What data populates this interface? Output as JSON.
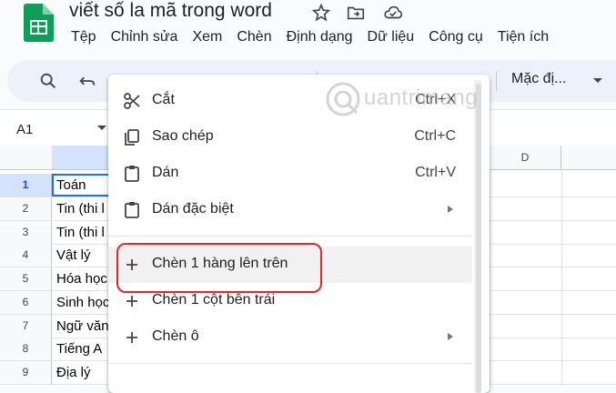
{
  "app": {
    "doc_title": "viết số la mã trong word",
    "menu": [
      "Tệp",
      "Chỉnh sửa",
      "Xem",
      "Chèn",
      "Định dạng",
      "Dữ liệu",
      "Công cụ",
      "Tiện ích"
    ]
  },
  "toolbar": {
    "font_select": "Mặc đị..."
  },
  "formula_bar": {
    "name_box": "A1"
  },
  "grid": {
    "column_headers": [
      "",
      "D"
    ],
    "rows": [
      {
        "num": "1",
        "a": "Toán"
      },
      {
        "num": "2",
        "a": "Tin (thi l"
      },
      {
        "num": "3",
        "a": "Tin (thi l"
      },
      {
        "num": "4",
        "a": "Vật lý"
      },
      {
        "num": "5",
        "a": "Hóa học"
      },
      {
        "num": "6",
        "a": "Sinh học"
      },
      {
        "num": "7",
        "a": "Ngữ văn"
      },
      {
        "num": "8",
        "a": "Tiếng A"
      },
      {
        "num": "9",
        "a": "Địa lý"
      }
    ]
  },
  "context_menu": {
    "items": [
      {
        "label": "Cắt",
        "shortcut": "Ctrl+X",
        "icon": "scissors-icon"
      },
      {
        "label": "Sao chép",
        "shortcut": "Ctrl+C",
        "icon": "copy-icon"
      },
      {
        "label": "Dán",
        "shortcut": "Ctrl+V",
        "icon": "paste-icon"
      },
      {
        "label": "Dán đặc biệt",
        "shortcut": "",
        "icon": "paste-special-icon"
      },
      {
        "label": "Chèn 1 hàng lên trên",
        "shortcut": "",
        "icon": "plus-icon"
      },
      {
        "label": "Chèn 1 cột bên trái",
        "shortcut": "",
        "icon": "plus-icon"
      },
      {
        "label": "Chèn ô",
        "shortcut": "",
        "icon": "plus-icon"
      }
    ]
  },
  "watermark": {
    "text": "uantrimang"
  },
  "colors": {
    "highlight": "#e3262e",
    "selection": "#1a73e8",
    "sheets_green": "#0f9d58"
  }
}
